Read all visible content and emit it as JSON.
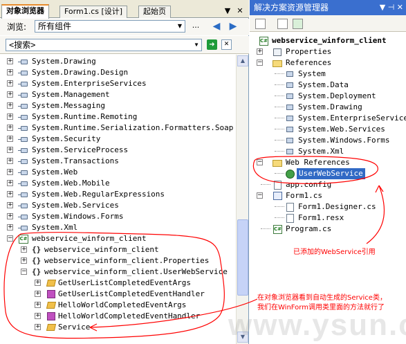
{
  "object_browser": {
    "tabs": [
      "对象浏览器",
      "Form1.cs [设计]",
      "起始页"
    ],
    "tab_controls": {
      "dropdown": "▼",
      "close": "✕"
    },
    "browse_label": "浏览:",
    "scope_value": "所有组件",
    "ellipsis": "...",
    "search_placeholder": "<搜索>",
    "assemblies": [
      "System.Drawing",
      "System.Drawing.Design",
      "System.EnterpriseServices",
      "System.Management",
      "System.Messaging",
      "System.Runtime.Remoting",
      "System.Runtime.Serialization.Formatters.Soap",
      "System.Security",
      "System.ServiceProcess",
      "System.Transactions",
      "System.Web",
      "System.Web.Mobile",
      "System.Web.RegularExpressions",
      "System.Web.Services",
      "System.Windows.Forms",
      "System.Xml"
    ],
    "project": "webservice_winform_client",
    "namespaces": [
      "webservice_winform_client",
      "webservice_winform_client.Properties",
      "webservice_winform_client.UserWebService"
    ],
    "types": [
      {
        "name": "GetUserListCompletedEventArgs",
        "kind": "class"
      },
      {
        "name": "GetUserListCompletedEventHandler",
        "kind": "delegate"
      },
      {
        "name": "HelloWorldCompletedEventArgs",
        "kind": "class"
      },
      {
        "name": "HelloWorldCompletedEventHandler",
        "kind": "delegate"
      },
      {
        "name": "Service",
        "kind": "class"
      }
    ]
  },
  "solution_explorer": {
    "title": "解决方案资源管理器",
    "title_controls": "▼ ⊣ ✕",
    "project": "webservice_winform_client",
    "items": {
      "properties": "Properties",
      "references": "References",
      "refs": [
        "System",
        "System.Data",
        "System.Deployment",
        "System.Drawing",
        "System.EnterpriseServices",
        "System.Web.Services",
        "System.Windows.Forms",
        "System.Xml"
      ],
      "web_references": "Web References",
      "user_web_service": "UserWebService",
      "app_config": "app.config",
      "form1": "Form1.cs",
      "form1_designer": "Form1.Designer.cs",
      "form1_resx": "Form1.resx",
      "program": "Program.cs"
    }
  },
  "annotations": {
    "added_ref": "已添加的WebService引用",
    "object_browser_note": "在对象浏览器看到自动生成的Service类，我们在WinForm调用类里面的方法就行了",
    "color": "#ff0000"
  },
  "watermark": "www.ysun.com"
}
